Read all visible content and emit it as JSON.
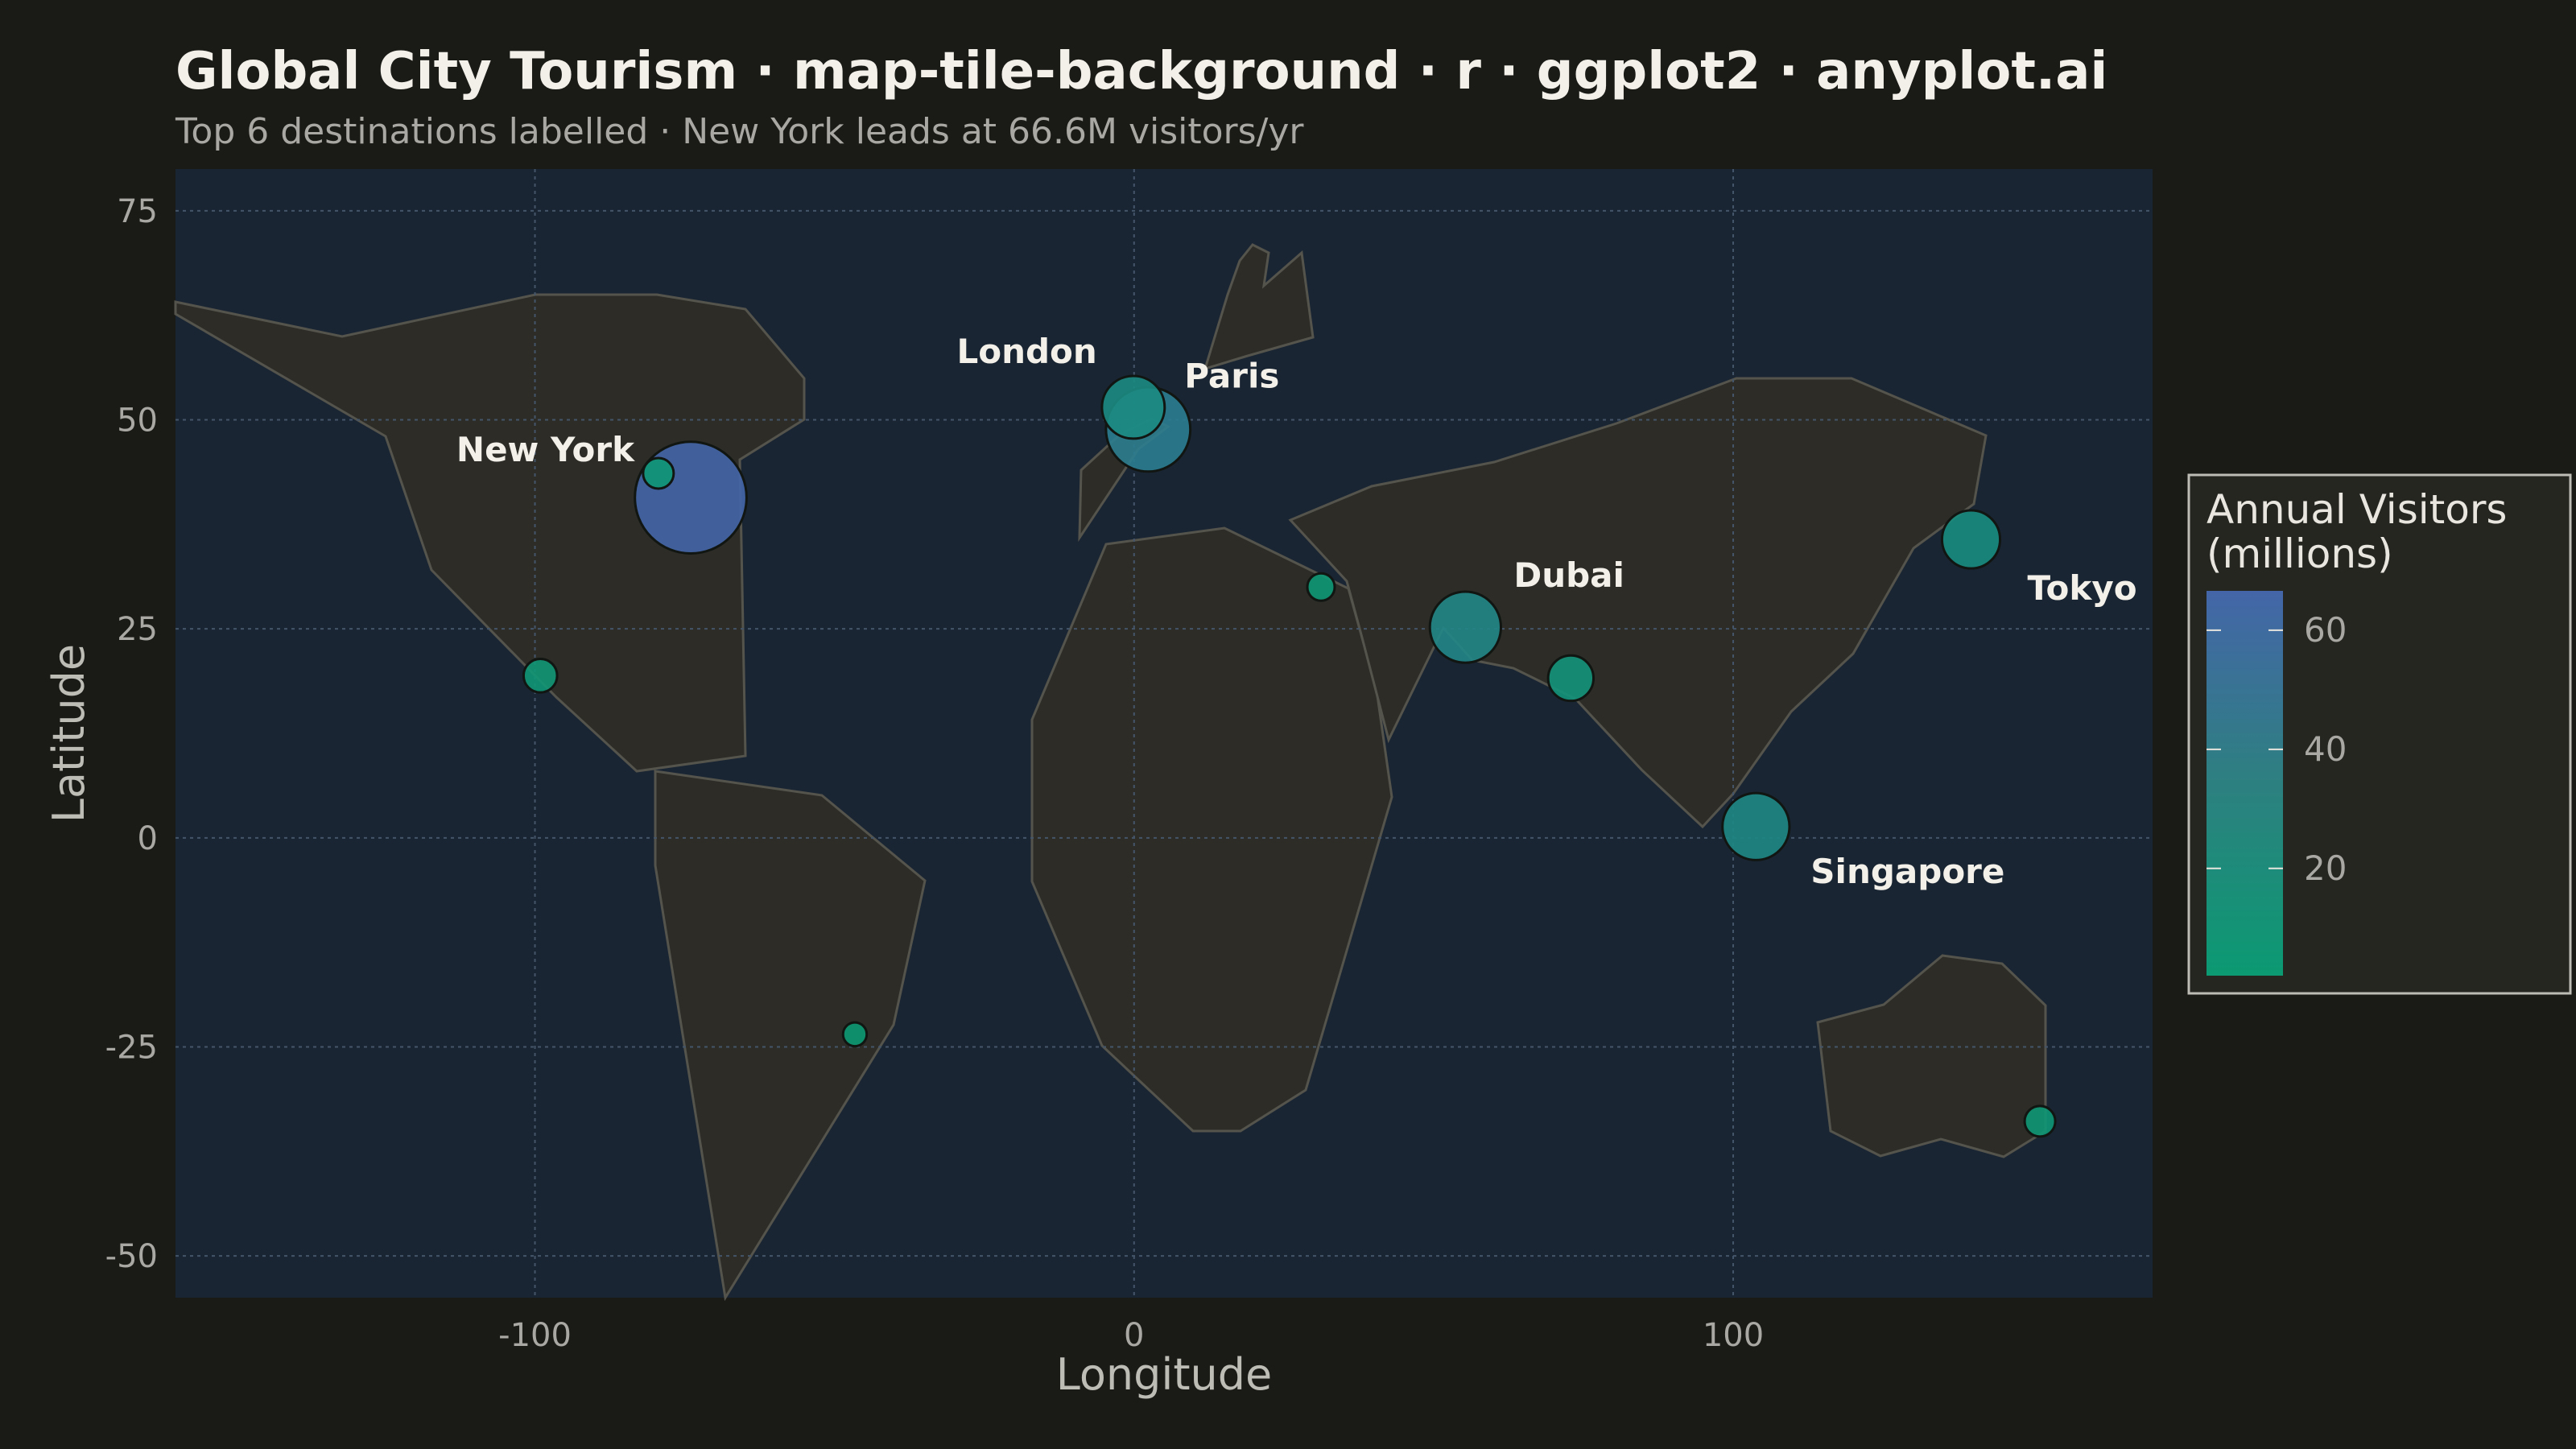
{
  "title": "Global City Tourism · map-tile-background · r · ggplot2 · anyplot.ai",
  "subtitle": "Top 6 destinations labelled · New York leads at 66.6M visitors/yr",
  "colors": {
    "page_bg": "#1a1a17",
    "panel_bg": "#1a2533",
    "land": "#2d2c27",
    "land_border": "#55544c",
    "grid": "#44556a",
    "scale_low": "#0b9a72",
    "scale_high": "#4466a8"
  },
  "chart_data": {
    "type": "scatter",
    "title": "Global City Tourism · map-tile-background · r · ggplot2 · anyplot.ai",
    "subtitle": "Top 6 destinations labelled · New York leads at 66.6M visitors/yr",
    "xlabel": "Longitude",
    "ylabel": "Latitude",
    "xlim": [
      -160,
      170
    ],
    "ylim": [
      -55,
      80
    ],
    "x_ticks": [
      -100,
      0,
      100
    ],
    "y_ticks": [
      75,
      50,
      25,
      0,
      -25,
      -50
    ],
    "grid": true,
    "legend": {
      "title_lines": [
        "Annual Visitors",
        "(millions)"
      ],
      "position": "right",
      "min": 2,
      "max": 66.6,
      "ticks": [
        60,
        40,
        20
      ]
    },
    "points": [
      {
        "lon": -74.0,
        "lat": 40.7,
        "visitors": 66.6,
        "label": "New York"
      },
      {
        "lon": 2.35,
        "lat": 48.86,
        "visitors": 38,
        "label": "Paris"
      },
      {
        "lon": -0.13,
        "lat": 51.5,
        "visitors": 21,
        "label": "London"
      },
      {
        "lon": 55.3,
        "lat": 25.2,
        "visitors": 27,
        "label": "Dubai"
      },
      {
        "lon": 103.8,
        "lat": 1.35,
        "visitors": 24,
        "label": "Singapore"
      },
      {
        "lon": 139.7,
        "lat": 35.7,
        "visitors": 18,
        "label": "Tokyo"
      },
      {
        "lon": -79.4,
        "lat": 43.6,
        "visitors": 5,
        "label": ""
      },
      {
        "lon": -99.1,
        "lat": 19.4,
        "visitors": 6,
        "label": ""
      },
      {
        "lon": -46.6,
        "lat": -23.5,
        "visitors": 3,
        "label": ""
      },
      {
        "lon": 31.2,
        "lat": 30.0,
        "visitors": 4,
        "label": ""
      },
      {
        "lon": 72.9,
        "lat": 19.1,
        "visitors": 11,
        "label": ""
      },
      {
        "lon": 151.2,
        "lat": -33.9,
        "visitors": 5,
        "label": ""
      }
    ]
  }
}
